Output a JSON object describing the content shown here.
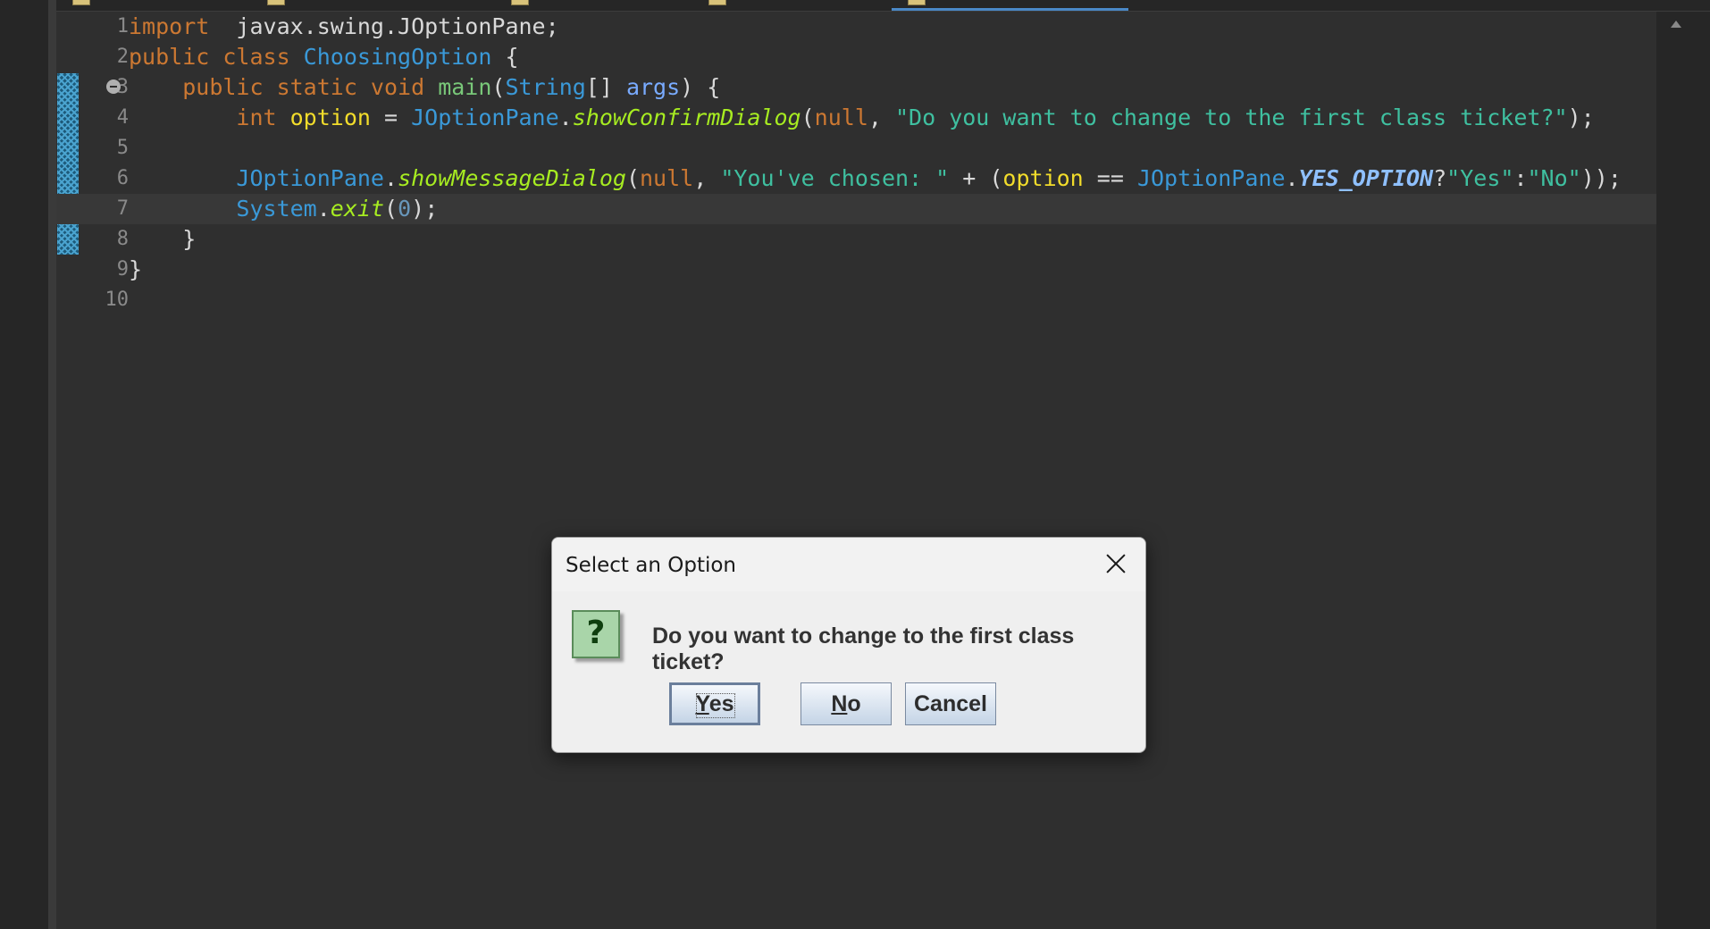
{
  "editor": {
    "lines": [
      {
        "num": "1",
        "parts": [
          [
            "k-orange",
            "import"
          ],
          [
            "",
            "  javax.swing.JOptionPane;"
          ]
        ]
      },
      {
        "num": "2",
        "parts": [
          [
            "k-orange",
            "public class"
          ],
          [
            "k-type",
            " ChoosingOption"
          ],
          [
            "",
            " {"
          ]
        ]
      },
      {
        "num": "3",
        "fold": true,
        "parts": [
          [
            "",
            "    "
          ],
          [
            "k-orange",
            "public static void"
          ],
          [
            "k-green",
            " main"
          ],
          [
            "",
            "("
          ],
          [
            "k-type",
            "String"
          ],
          [
            "",
            "[] "
          ],
          [
            "k-param",
            "args"
          ],
          [
            "",
            ") {"
          ]
        ]
      },
      {
        "num": "4",
        "parts": [
          [
            "",
            "        "
          ],
          [
            "k-orange",
            "int"
          ],
          [
            "k-var",
            " option"
          ],
          [
            "",
            " = "
          ],
          [
            "k-type",
            "JOptionPane"
          ],
          [
            "",
            "."
          ],
          [
            "k-italic",
            "showConfirmDialog"
          ],
          [
            "",
            "("
          ],
          [
            "k-null",
            "null"
          ],
          [
            "",
            ", "
          ],
          [
            "k-str",
            "\"Do you want to change to the first class ticket?\""
          ],
          [
            "",
            ");"
          ]
        ]
      },
      {
        "num": "5",
        "parts": []
      },
      {
        "num": "6",
        "parts": [
          [
            "",
            "        "
          ],
          [
            "k-type",
            "JOptionPane"
          ],
          [
            "",
            "."
          ],
          [
            "k-italic",
            "showMessageDialog"
          ],
          [
            "",
            "("
          ],
          [
            "k-null",
            "null"
          ],
          [
            "",
            ", "
          ],
          [
            "k-str",
            "\"You've chosen: \""
          ],
          [
            "",
            " + ("
          ],
          [
            "k-var",
            "option"
          ],
          [
            "",
            " == "
          ],
          [
            "k-type",
            "JOptionPane"
          ],
          [
            "",
            "."
          ],
          [
            "k-const",
            "YES_OPTION"
          ],
          [
            "",
            "?"
          ],
          [
            "k-str",
            "\"Yes\""
          ],
          [
            "",
            ":"
          ],
          [
            "k-str",
            "\"No\""
          ],
          [
            "",
            "));"
          ]
        ]
      },
      {
        "num": "7",
        "current": true,
        "parts": [
          [
            "",
            "        "
          ],
          [
            "k-type",
            "System"
          ],
          [
            "",
            "."
          ],
          [
            "k-italic",
            "exit"
          ],
          [
            "",
            "("
          ],
          [
            "k-num",
            "0"
          ],
          [
            "",
            ");"
          ]
        ]
      },
      {
        "num": "8",
        "parts": [
          [
            "",
            "    }"
          ]
        ]
      },
      {
        "num": "9",
        "parts": [
          [
            "",
            "}"
          ]
        ]
      },
      {
        "num": "10",
        "parts": []
      }
    ]
  },
  "dialog": {
    "title": "Select an Option",
    "icon": "question-icon",
    "icon_glyph": "?",
    "message": "Do you want to change to the first class ticket?",
    "buttons": {
      "yes_mnemonic": "Y",
      "yes_rest": "es",
      "no_mnemonic": "N",
      "no_rest": "o",
      "cancel": "Cancel"
    }
  },
  "colors": {
    "editor_bg": "#2f2f2f",
    "keyword": "#cc7832",
    "type": "#3a99d8",
    "string": "#3fc0a0",
    "variable": "#f2dc2b"
  }
}
